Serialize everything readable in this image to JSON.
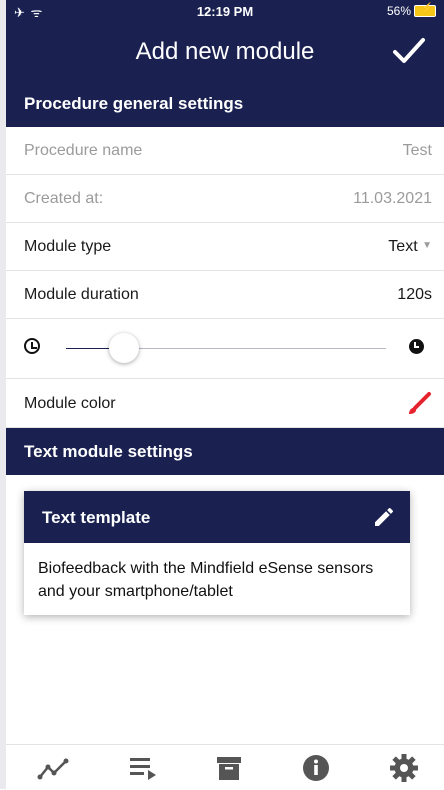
{
  "status_bar": {
    "left_icons": "✈ ᯤ",
    "time": "12:19 PM",
    "battery": "56%"
  },
  "header": {
    "title": "Add new module",
    "confirm_icon": "checkmark-icon"
  },
  "general_section": {
    "title": "Procedure general settings",
    "procedure_name_label": "Procedure name",
    "procedure_name_value": "Test",
    "created_label": "Created at:",
    "created_value": "11.03.2021",
    "module_type_label": "Module type",
    "module_type_value": "Text",
    "duration_label": "Module duration",
    "duration_value": "120s",
    "duration_slider_fraction": 0.18,
    "color_label": "Module color",
    "color_value": "#e5232e"
  },
  "text_section": {
    "title": "Text module settings",
    "card_title": "Text template",
    "card_text": "Biofeedback with the Mindfield eSense sensors and your smartphone/tablet"
  },
  "bottom_nav": {
    "items": [
      {
        "icon": "chart-line-icon"
      },
      {
        "icon": "playlist-icon"
      },
      {
        "icon": "archive-icon"
      },
      {
        "icon": "info-icon"
      },
      {
        "icon": "gear-icon"
      }
    ]
  },
  "colors": {
    "primary": "#1a2151",
    "accent": "#e5232e"
  }
}
